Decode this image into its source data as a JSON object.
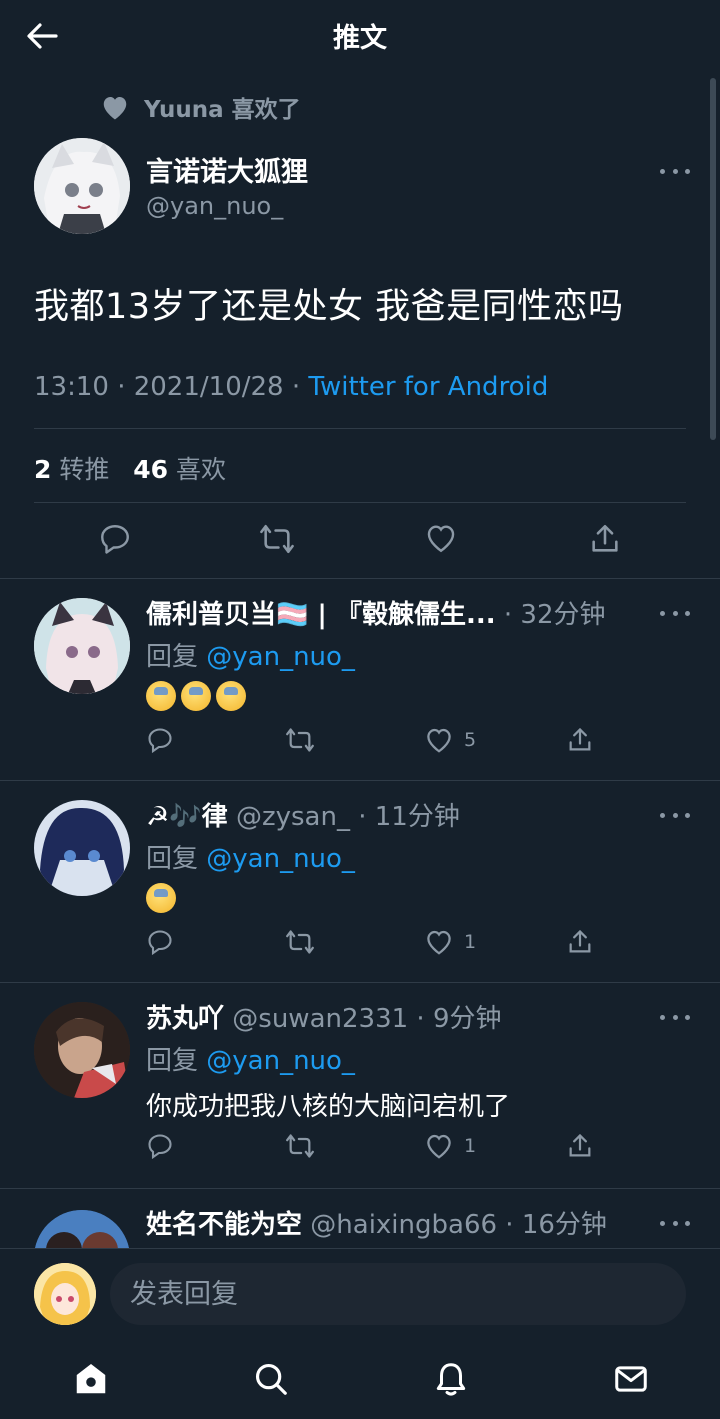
{
  "header": {
    "title": "推文"
  },
  "liked_by": {
    "text": "Yuuna 喜欢了"
  },
  "main_tweet": {
    "display_name": "言诺诺大狐狸",
    "handle": "@yan_nuo_",
    "text": "我都13岁了还是处女 我爸是同性恋吗",
    "time_date": "13:10 · 2021/10/28 · ",
    "source": "Twitter for Android",
    "retweet_count": "2",
    "retweet_label": "转推",
    "like_count": "46",
    "like_label": "喜欢"
  },
  "replies": [
    {
      "display_name": "儒利普贝当🏳️‍⚧️ | 『毂觫儒生...",
      "meta": " · 32分钟",
      "reply_prefix": "回复 ",
      "reply_to": "@yan_nuo_",
      "body": "",
      "emoji_count": 3,
      "like_count": "5"
    },
    {
      "display_name": "☭🎶律",
      "handle": " @zysan_",
      "meta": " · 11分钟",
      "reply_prefix": "回复 ",
      "reply_to": "@yan_nuo_",
      "body": "",
      "emoji_count": 1,
      "like_count": "1"
    },
    {
      "display_name": "苏丸吖",
      "handle": " @suwan2331",
      "meta": " · 9分钟",
      "reply_prefix": "回复 ",
      "reply_to": "@yan_nuo_",
      "body": "你成功把我八核的大脑问宕机了",
      "like_count": "1"
    },
    {
      "display_name": "姓名不能为空",
      "handle": " @haixingba66",
      "meta": " · 16分钟"
    }
  ],
  "composer": {
    "placeholder": "发表回复"
  },
  "colors": {
    "background": "#15202b",
    "accent": "#1d9bf0",
    "muted": "#8b98a5"
  }
}
